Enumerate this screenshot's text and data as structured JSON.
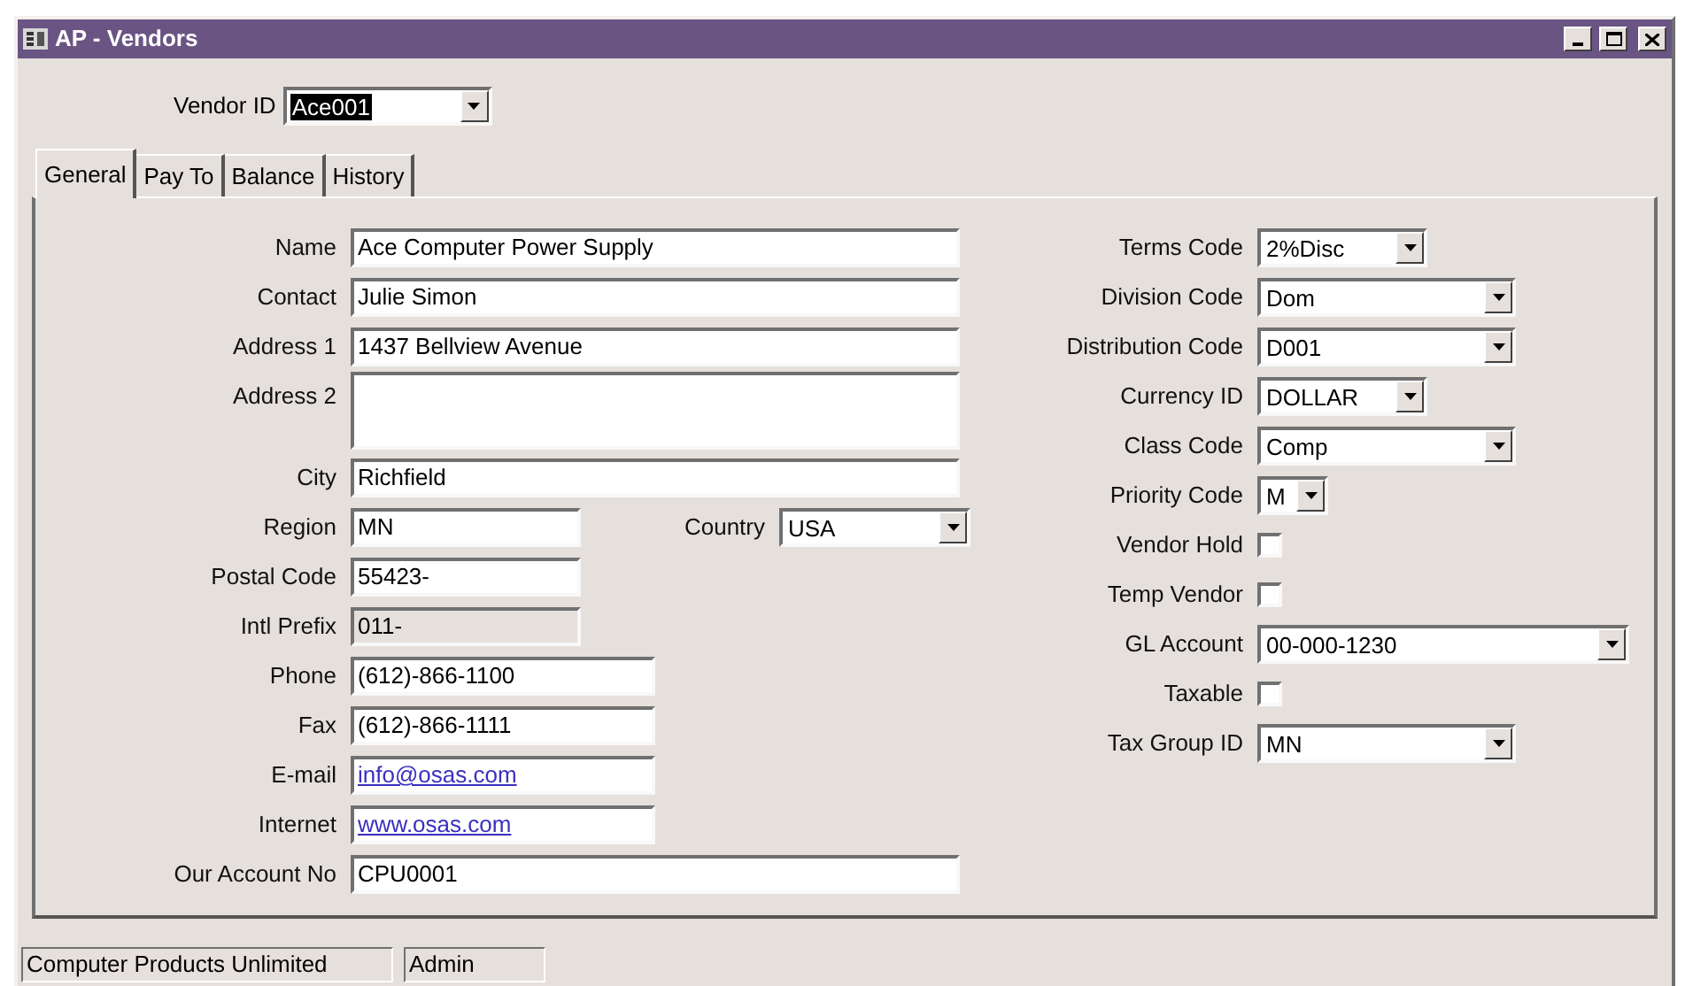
{
  "window": {
    "title": "AP - Vendors"
  },
  "vendor_id": {
    "label": "Vendor ID",
    "value": "Ace001",
    "highlighted": true
  },
  "tabs": [
    {
      "label": "General",
      "selected": true
    },
    {
      "label": "Pay To",
      "selected": false
    },
    {
      "label": "Balance",
      "selected": false
    },
    {
      "label": "History",
      "selected": false
    }
  ],
  "left_fields": [
    {
      "kind": "text",
      "label": "Name",
      "value": "Ace Computer Power  Supply"
    },
    {
      "kind": "text",
      "label": "Contact",
      "value": "Julie Simon"
    },
    {
      "kind": "text",
      "label": "Address 1",
      "value": "1437 Bellview Avenue"
    },
    {
      "kind": "multiline",
      "label": "Address 2"
    },
    {
      "kind": "text",
      "label": "City",
      "value": "Richfield"
    },
    {
      "kind": "text",
      "label": "Region",
      "value": "MN",
      "beside": {
        "label": "Country",
        "value": "USA"
      }
    },
    {
      "kind": "text",
      "label": "Postal Code",
      "value": "55423-"
    },
    {
      "kind": "readonly",
      "label": "Intl Prefix",
      "value": "011-"
    },
    {
      "kind": "text",
      "label": "Phone",
      "value": "(612)-866-1100"
    },
    {
      "kind": "text",
      "label": "Fax",
      "value": "(612)-866-1111"
    },
    {
      "kind": "link",
      "label": "E-mail",
      "value": "info@osas.com"
    },
    {
      "kind": "link",
      "label": "Internet",
      "value": "www.osas.com"
    },
    {
      "kind": "text",
      "label": "Our Account No",
      "value": "CPU0001"
    }
  ],
  "right_fields": [
    {
      "kind": "combo",
      "label": "Terms Code",
      "value": "2%Disc"
    },
    {
      "kind": "combo",
      "label": "Division Code",
      "value": "Dom"
    },
    {
      "kind": "combo",
      "label": "Distribution Code",
      "value": "D001"
    },
    {
      "kind": "combo",
      "label": "Currency ID",
      "value": "DOLLAR"
    },
    {
      "kind": "combo",
      "label": "Class Code",
      "value": "Comp"
    },
    {
      "kind": "combo",
      "label": "Priority Code",
      "value": "M"
    },
    {
      "kind": "checkbox",
      "label": "Vendor Hold",
      "checked": false
    },
    {
      "kind": "checkbox",
      "label": "Temp Vendor",
      "checked": false
    },
    {
      "kind": "combo",
      "label": "GL Account",
      "value": "00-000-1230"
    },
    {
      "kind": "checkbox",
      "label": "Taxable",
      "checked": false
    },
    {
      "kind": "combo",
      "label": "Tax Group ID",
      "value": "MN"
    }
  ],
  "status_bar": [
    "Computer Products Unlimited",
    "Admin"
  ]
}
